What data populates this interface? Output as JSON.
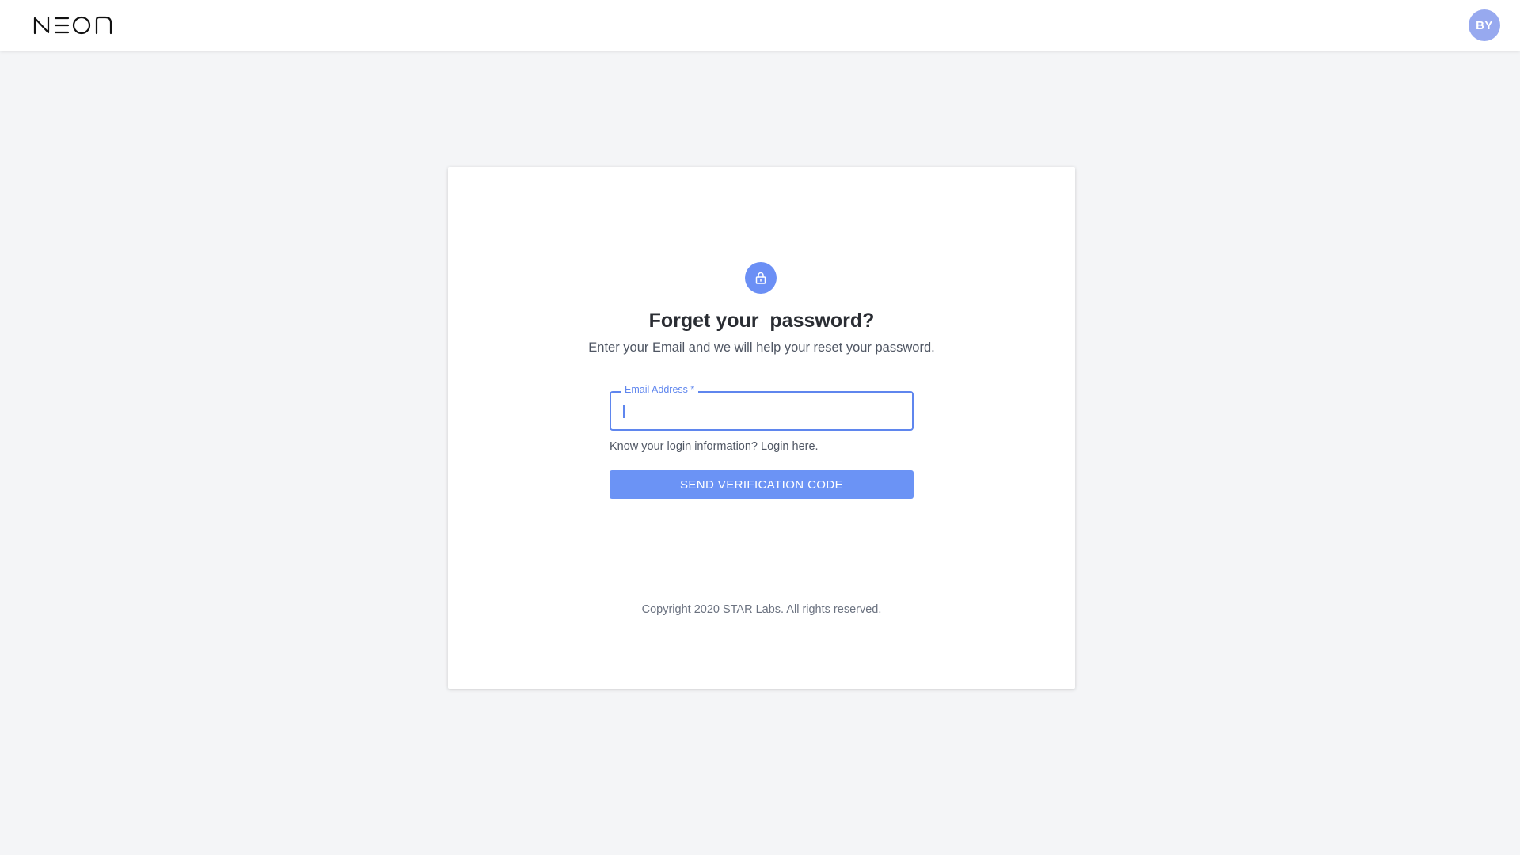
{
  "header": {
    "logo_text": "NEON",
    "avatar_initials": "BY"
  },
  "form": {
    "icon": "lock-icon",
    "title": "Forget your  password?",
    "subtitle": "Enter your Email and we will help your reset your password.",
    "email_label": "Email Address *",
    "email_value": "",
    "login_link": "Know your login information? Login here.",
    "submit_label": "SEND VERIFICATION CODE"
  },
  "footer": {
    "copyright": "Copyright 2020 STAR Labs. All rights reserved."
  },
  "colors": {
    "accent": "#6b93f5",
    "avatar": "#97a9ef",
    "background": "#f4f5f7"
  }
}
